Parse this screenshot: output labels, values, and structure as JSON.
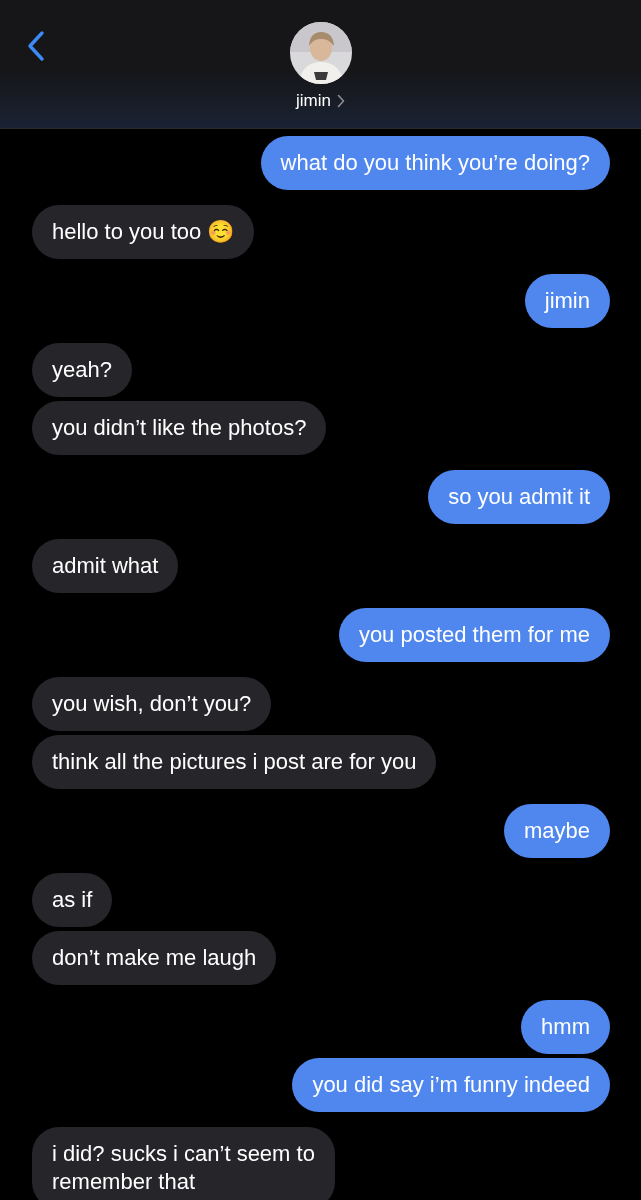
{
  "header": {
    "contact_name": "jimin"
  },
  "messages": [
    {
      "kind": "sent",
      "text": "what do you think you’re doing?"
    },
    {
      "kind": "received",
      "text": "hello to you too ☺️"
    },
    {
      "kind": "sent",
      "text": "jimin"
    },
    {
      "kind": "received",
      "text": "yeah?"
    },
    {
      "kind": "received",
      "text": "you didn’t like the photos?"
    },
    {
      "kind": "sent",
      "text": "so you admit it"
    },
    {
      "kind": "received",
      "text": "admit what"
    },
    {
      "kind": "sent",
      "text": "you posted them for me"
    },
    {
      "kind": "received",
      "text": "you wish, don’t you?"
    },
    {
      "kind": "received",
      "text": "think all the pictures i post are for you"
    },
    {
      "kind": "sent",
      "text": "maybe"
    },
    {
      "kind": "received",
      "text": "as if"
    },
    {
      "kind": "received",
      "text": "don’t make me laugh"
    },
    {
      "kind": "sent",
      "text": "hmm"
    },
    {
      "kind": "sent",
      "text": "you did say i’m funny indeed"
    },
    {
      "kind": "received",
      "text": "i did? sucks i can’t seem to\nremember that"
    }
  ]
}
